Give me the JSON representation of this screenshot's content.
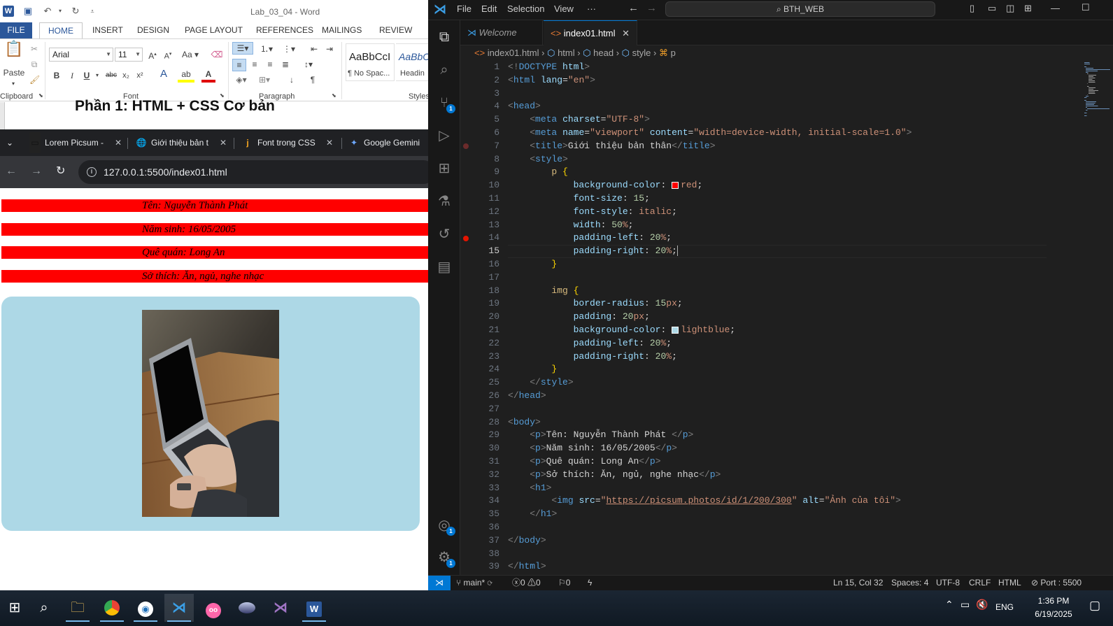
{
  "word": {
    "title": "Lab_03_04 - Word",
    "tabs": [
      "FILE",
      "HOME",
      "INSERT",
      "DESIGN",
      "PAGE LAYOUT",
      "REFERENCES",
      "MAILINGS",
      "REVIEW"
    ],
    "font_name": "Arial",
    "font_size": "11",
    "paste_label": "Paste",
    "group_labels": {
      "clipboard": "Clipboard",
      "font": "Font",
      "paragraph": "Paragraph",
      "styles": "Styles"
    },
    "styles": [
      {
        "preview": "AaBbCcI",
        "name": "¶ No Spac..."
      },
      {
        "preview": "AaBbC",
        "name": "Headin"
      }
    ],
    "doc_heading": "Phần 1: HTML + CSS Cơ bản"
  },
  "chrome": {
    "tabs": [
      {
        "label": "Lorem Picsum -",
        "icon": "picsum-icon"
      },
      {
        "label": "Giới thiệu bản t",
        "icon": "globe-icon"
      },
      {
        "label": "Font trong CSS",
        "icon": "j-icon"
      },
      {
        "label": "Google Gemini",
        "icon": "gemini-icon"
      }
    ],
    "url": "127.0.0.1:5500/index01.html"
  },
  "page": {
    "lines": [
      "Tên: Nguyễn Thành Phát",
      "Năm sinh: 16/05/2005",
      "Quê quán: Long An",
      "Sở thích: Ăn, ngủ, nghe nhạc"
    ],
    "image_alt": "Ảnh của tôi"
  },
  "vscode": {
    "menu": [
      "File",
      "Edit",
      "Selection",
      "View",
      "···"
    ],
    "search": "BTH_WEB",
    "tabs": [
      {
        "label": "Welcome"
      },
      {
        "label": "index01.html"
      }
    ],
    "breadcrumb": [
      "index01.html",
      "html",
      "head",
      "style",
      "p"
    ],
    "lines": [
      "<!DOCTYPE html>",
      "<html lang=\"en\">",
      "",
      "<head>",
      "    <meta charset=\"UTF-8\">",
      "    <meta name=\"viewport\" content=\"width=device-width, initial-scale=1.0\">",
      "    <title>Giới thiệu bản thân</title>",
      "    <style>",
      "        p {",
      "            background-color: red;",
      "            font-size: 15;",
      "            font-style: italic;",
      "            width: 50%;",
      "            padding-left: 20%;",
      "            padding-right: 20%;",
      "        }",
      "",
      "        img {",
      "            border-radius: 15px;",
      "            padding: 20px;",
      "            background-color: lightblue;",
      "            padding-left: 20%;",
      "            padding-right: 20%;",
      "        }",
      "    </style>",
      "</head>",
      "",
      "<body>",
      "    <p>Tên: Nguyễn Thành Phát </p>",
      "    <p>Năm sinh: 16/05/2005</p>",
      "    <p>Quê quán: Long An</p>",
      "    <p>Sở thích: Ăn, ngủ, nghe nhạc</p>",
      "    <h1>",
      "        <img src=\"https://picsum.photos/id/1/200/300\" alt=\"Ảnh của tôi\">",
      "    </h1>",
      "",
      "</body>",
      "",
      "</html>"
    ],
    "current_line": 15,
    "status": {
      "branch": "main*",
      "errors": "0",
      "warnings": "0",
      "ports": "0",
      "position": "Ln 15, Col 32",
      "spaces": "Spaces: 4",
      "encoding": "UTF-8",
      "eol": "CRLF",
      "language": "HTML",
      "port": "Port : 5500"
    },
    "badges": {
      "source_control": "1",
      "accounts": "1",
      "settings": "1"
    }
  },
  "taskbar": {
    "lang": "ENG",
    "time": "1:36 PM",
    "date": "6/19/2025",
    "apps": [
      "search-icon",
      "file-explorer-icon",
      "chrome-icon",
      "app-icon",
      "vscode-icon",
      "osu-icon",
      "app2-icon",
      "visual-studio-icon",
      "word-icon"
    ]
  },
  "colors": {
    "red": "#ff0000",
    "lightblue": "#add8e6",
    "vscode_bg": "#1f1f1f",
    "vscode_accent": "#0078d4",
    "word_blue": "#2b579a"
  }
}
